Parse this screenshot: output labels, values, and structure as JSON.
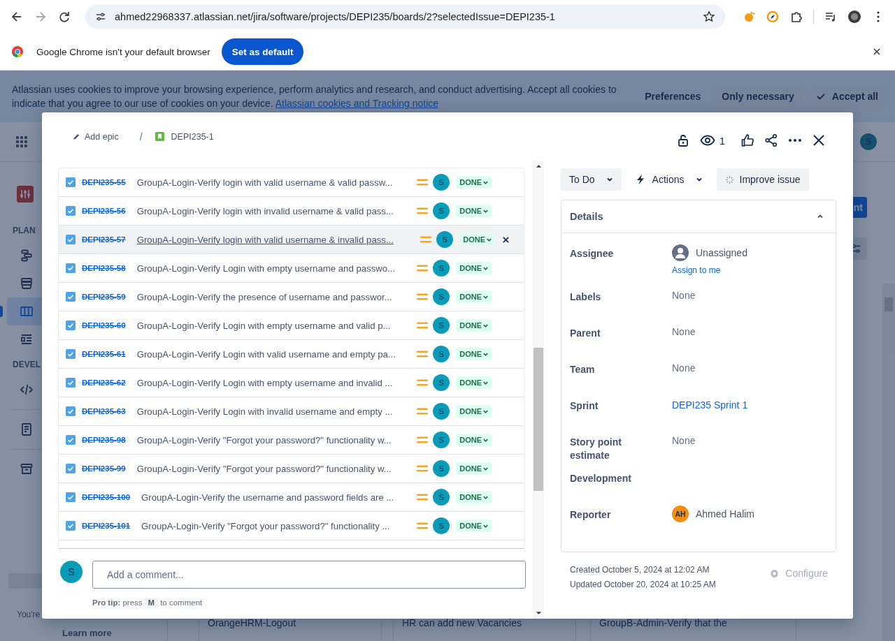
{
  "browser": {
    "url": "ahmed22968337.atlassian.net/jira/software/projects/DEPI235/boards/2?selectedIssue=DEPI235-1",
    "forward_disabled": true,
    "infobar": {
      "message": "Google Chrome isn't your default browser",
      "button": "Set as default"
    }
  },
  "cookie_banner": {
    "text": "Atlassian uses cookies to improve your browsing experience, perform analytics and research, and conduct advertising. Accept all cookies to indicate that you agree to our use of cookies on your device.",
    "link": "Atlassian cookies and Tracking notice",
    "buttons": [
      "Preferences",
      "Only necessary",
      "Accept all"
    ]
  },
  "top_nav": {
    "avatar": "S",
    "create_button": "nt"
  },
  "sidebar": {
    "items": [
      {
        "kind": "project"
      },
      {
        "kind": "heading",
        "label": "PLAN"
      },
      {
        "kind": "timeline",
        "selected": false
      },
      {
        "kind": "backlog",
        "selected": false
      },
      {
        "kind": "board",
        "selected": true
      },
      {
        "kind": "forms",
        "selected": false
      },
      {
        "kind": "heading",
        "label": "DEVEL"
      },
      {
        "kind": "code",
        "selected": false
      },
      {
        "kind": "divider"
      },
      {
        "kind": "pages",
        "selected": false
      },
      {
        "kind": "divider"
      },
      {
        "kind": "archive",
        "selected": false
      }
    ],
    "note": "You're",
    "link": "Learn more"
  },
  "board_cards": [
    "OrangeHRM-Logout",
    "HR can add new Vacancies",
    "GroupB-Admin-Verify that the"
  ],
  "issue": {
    "breadcrumb": {
      "epic_action": "Add epic",
      "separator": "/",
      "key": "DEPI235-1"
    },
    "watchers": "1",
    "child_issues": [
      {
        "key": "DEPI235-55",
        "summary": "GroupA-Login-Verify login with valid username & valid passw...",
        "done": true,
        "status": "DONE",
        "assignee": "S",
        "hovered": false
      },
      {
        "key": "DEPI235-56",
        "summary": "GroupA-Login-Verify login with invalid username & valid pass...",
        "done": true,
        "status": "DONE",
        "assignee": "S",
        "hovered": false
      },
      {
        "key": "DEPI235-57",
        "summary": "GroupA-Login-Verify login with valid username & invalid pass...",
        "done": true,
        "status": "DONE",
        "assignee": "S",
        "hovered": true
      },
      {
        "key": "DEPI235-58",
        "summary": "GroupA-Login-Verify Login with empty username and passwo...",
        "done": true,
        "status": "DONE",
        "assignee": "S",
        "hovered": false
      },
      {
        "key": "DEPI235-59",
        "summary": "GroupA-Login-Verify the presence of username and passwor...",
        "done": true,
        "status": "DONE",
        "assignee": "S",
        "hovered": false
      },
      {
        "key": "DEPI235-60",
        "summary": "GroupA-Login-Verify Login with empty username and valid p...",
        "done": true,
        "status": "DONE",
        "assignee": "S",
        "hovered": false
      },
      {
        "key": "DEPI235-61",
        "summary": "GroupA-Login-Verify Login with valid username and empty pa...",
        "done": true,
        "status": "DONE",
        "assignee": "S",
        "hovered": false
      },
      {
        "key": "DEPI235-62",
        "summary": "GroupA-Login-Verify Login with empty username and invalid ...",
        "done": true,
        "status": "DONE",
        "assignee": "S",
        "hovered": false
      },
      {
        "key": "DEPI235-63",
        "summary": "GroupA-Login-Verify Login with invalid username and empty ...",
        "done": true,
        "status": "DONE",
        "assignee": "S",
        "hovered": false
      },
      {
        "key": "DEPI235-98",
        "summary": "GroupA-Login-Verify \"Forgot your password?\" functionality w...",
        "done": true,
        "status": "DONE",
        "assignee": "S",
        "hovered": false
      },
      {
        "key": "DEPI235-99",
        "summary": "GroupA-Login-Verify \"Forgot your password?\" functionality w...",
        "done": true,
        "status": "DONE",
        "assignee": "S",
        "hovered": false
      },
      {
        "key": "DEPI235-100",
        "summary": "GroupA-Login-Verify the username and password fields are ...",
        "done": true,
        "status": "DONE",
        "assignee": "S",
        "hovered": false
      },
      {
        "key": "DEPI235-101",
        "summary": "GroupA-Login-Verify \"Forgot your password?\" functionality ...",
        "done": true,
        "status": "DONE",
        "assignee": "S",
        "hovered": false
      }
    ],
    "comment": {
      "avatar": "S",
      "placeholder": "Add a comment...",
      "tip": "**Pro tip:** press",
      "tip_key": "M",
      "tip_end": "to comment"
    },
    "status_button": "To Do",
    "actions_button": "Actions",
    "improve_button": "Improve issue",
    "details": {
      "title": "Details",
      "expanded": true,
      "fields": [
        {
          "label": "Assignee",
          "kind": "unassigned",
          "value": "Unassigned",
          "action": "Assign to me"
        },
        {
          "label": "Labels",
          "kind": "text",
          "value": "None"
        },
        {
          "label": "Parent",
          "kind": "text",
          "value": "None"
        },
        {
          "label": "Team",
          "kind": "text",
          "value": "None"
        },
        {
          "label": "Sprint",
          "kind": "link",
          "value": "DEPI235 Sprint 1"
        },
        {
          "label": "Story point estimate",
          "kind": "text",
          "value": "None"
        },
        {
          "label": "Development",
          "kind": "empty"
        },
        {
          "label": "Reporter",
          "kind": "person",
          "initials": "AH",
          "value": "Ahmed Halim"
        }
      ]
    },
    "created": "Created October 5, 2024 at 12:02 AM",
    "updated": "Updated October 20, 2024 at 10:25 AM",
    "configure": "Configure"
  }
}
